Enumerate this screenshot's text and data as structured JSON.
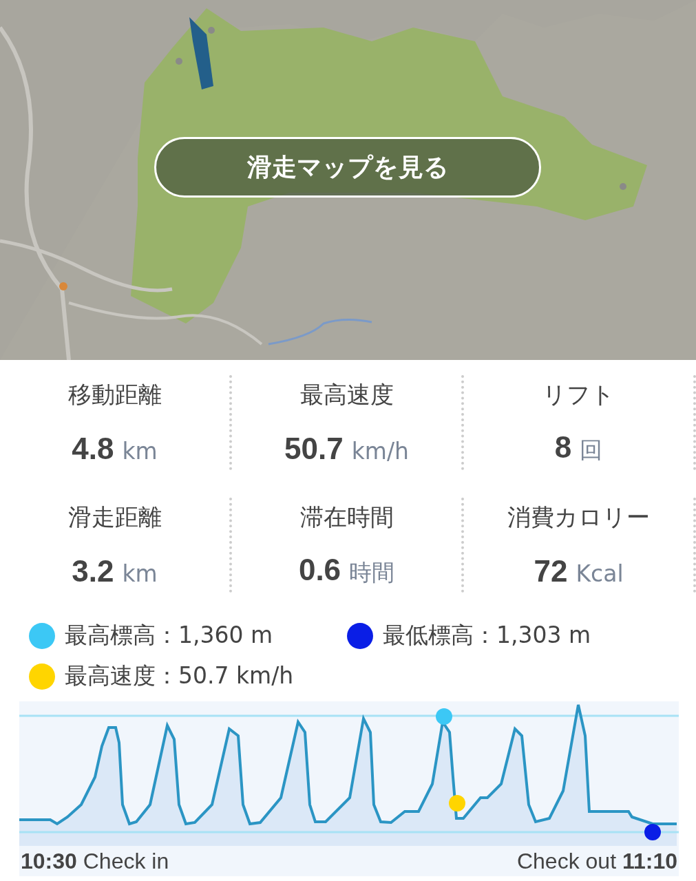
{
  "map": {
    "kind": "picture",
    "button": "滑走マップを見る"
  },
  "stats": [
    {
      "label": "移動距離",
      "value": "4.8",
      "unit": "km"
    },
    {
      "label": "最高速度",
      "value": "50.7",
      "unit": "km/h"
    },
    {
      "label": "リフト",
      "value": "8",
      "unit": "回"
    },
    {
      "label": "滑走距離",
      "value": "3.2",
      "unit": "km"
    },
    {
      "label": "滞在時間",
      "value": "0.6",
      "unit": "時間"
    },
    {
      "label": "消費カロリー",
      "value": "72",
      "unit": "Kcal"
    }
  ],
  "legend": [
    {
      "label": "最高標高：1,360 m",
      "color": "#3cc8f5"
    },
    {
      "label": "最低標高：1,303 m",
      "color": "#0a1ee6"
    },
    {
      "label": "最高速度：50.7 km/h",
      "color": "#ffd500"
    }
  ],
  "chart": {
    "start": "**10:30** Check in",
    "end": "Check out **11:10**"
  }
}
